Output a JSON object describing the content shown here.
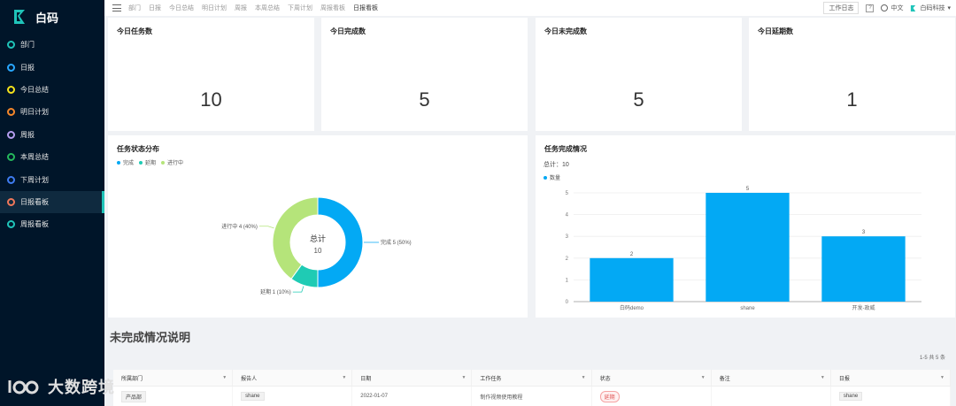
{
  "app": {
    "name": "白码"
  },
  "colors": {
    "sidebar_bg": "#001529",
    "accent_teal": "#1fc4b9",
    "blue": "#03a9f4",
    "teal": "#1fcbb4",
    "green_light": "#b5e47a"
  },
  "sidebar": {
    "items": [
      {
        "label": "部门",
        "ring_color": "#1fc4b9",
        "active": false
      },
      {
        "label": "日报",
        "ring_color": "#29a8ff",
        "active": false
      },
      {
        "label": "今日总结",
        "ring_color": "#f5e31c",
        "active": false
      },
      {
        "label": "明日计划",
        "ring_color": "#f5872a",
        "active": false
      },
      {
        "label": "周报",
        "ring_color": "#b59ef0",
        "active": false
      },
      {
        "label": "本周总结",
        "ring_color": "#25b85c",
        "active": false
      },
      {
        "label": "下周计划",
        "ring_color": "#3f7cf0",
        "active": false
      },
      {
        "label": "日报看板",
        "ring_color": "#f0785a",
        "active": true
      },
      {
        "label": "周报看板",
        "ring_color": "#1fc4b9",
        "active": false
      }
    ]
  },
  "topbar": {
    "crumbs": [
      "部门",
      "日报",
      "今日总结",
      "明日计划",
      "周报",
      "本周总结",
      "下周计划",
      "周报看板",
      "日报看板"
    ],
    "active_crumb": "日报看板",
    "work_log_label": "工作日志",
    "help_label": "?",
    "language": "中文",
    "company": "白码科技"
  },
  "stats": [
    {
      "title": "今日任务数",
      "value": "10"
    },
    {
      "title": "今日完成数",
      "value": "5"
    },
    {
      "title": "今日未完成数",
      "value": "5"
    },
    {
      "title": "今日延期数",
      "value": "1"
    }
  ],
  "pie_panel": {
    "title": "任务状态分布",
    "center_label": "总计",
    "center_value": "10",
    "legend": [
      {
        "name": "完成",
        "color": "#03a9f4"
      },
      {
        "name": "延期",
        "color": "#1fcbb4"
      },
      {
        "name": "进行中",
        "color": "#b5e47a"
      }
    ],
    "slice_labels": [
      "完成 5 (50%)",
      "延期 1 (10%)",
      "进行中 4 (40%)"
    ]
  },
  "bar_panel": {
    "title": "任务完成情况",
    "total_text": "总计：10",
    "legend": "数量"
  },
  "chart_data": [
    {
      "type": "pie",
      "title": "任务状态分布",
      "categories": [
        "完成",
        "延期",
        "进行中"
      ],
      "values": [
        5,
        1,
        4
      ],
      "colors": [
        "#03a9f4",
        "#1fcbb4",
        "#b5e47a"
      ],
      "donut": true,
      "legend_position": "top-left"
    },
    {
      "type": "bar",
      "title": "任务完成情况",
      "categories": [
        "白码demo",
        "shane",
        "开发-政威"
      ],
      "series": [
        {
          "name": "数量",
          "values": [
            2,
            5,
            3
          ]
        }
      ],
      "yticks": [
        "0",
        "1",
        "2",
        "3",
        "4",
        "5"
      ],
      "ylim": [
        0,
        5
      ],
      "grid": true,
      "legend_position": "top-left",
      "color": "#03a9f4"
    }
  ],
  "section": {
    "title": "未完成情况说明",
    "pagination": "1-5  共  5  条"
  },
  "table": {
    "headers": [
      "所属部门",
      "报告人",
      "日期",
      "工作任务",
      "状态",
      "备注",
      "日报"
    ],
    "rows": [
      [
        "产品部",
        "shane",
        "2022-01-07",
        "制作视频使用教程",
        "延期",
        "",
        "shane"
      ]
    ]
  },
  "watermark": {
    "text": "大数跨境"
  }
}
